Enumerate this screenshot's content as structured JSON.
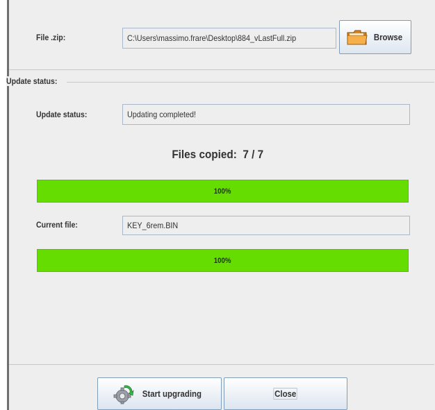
{
  "file_section": {
    "label": "File .zip:",
    "path_value": "C:\\Users\\massimo.frare\\Desktop\\884_vLastFull.zip",
    "browse_label": "Browse",
    "browse_icon": "folder-icon"
  },
  "status_group": {
    "title": "Update status:",
    "status_label": "Update status:",
    "status_value": "Updating completed!",
    "files_copied_label": "Files copied:",
    "files_copied_count": "7",
    "files_copied_separator": "/",
    "files_copied_total": "7",
    "total_progress": {
      "value": 100,
      "text": "100%"
    },
    "current_file_label": "Current file:",
    "current_file_value": "KEY_6rem.BIN",
    "file_progress": {
      "value": 100,
      "text": "100%"
    }
  },
  "buttons": {
    "start_label": "Start upgrading",
    "start_icon": "gear-upgrade-icon",
    "close_label": "Close"
  },
  "colors": {
    "progress_fill": "#66dd00",
    "panel_background": "#eeeeee",
    "field_border": "#a9b8c9"
  }
}
